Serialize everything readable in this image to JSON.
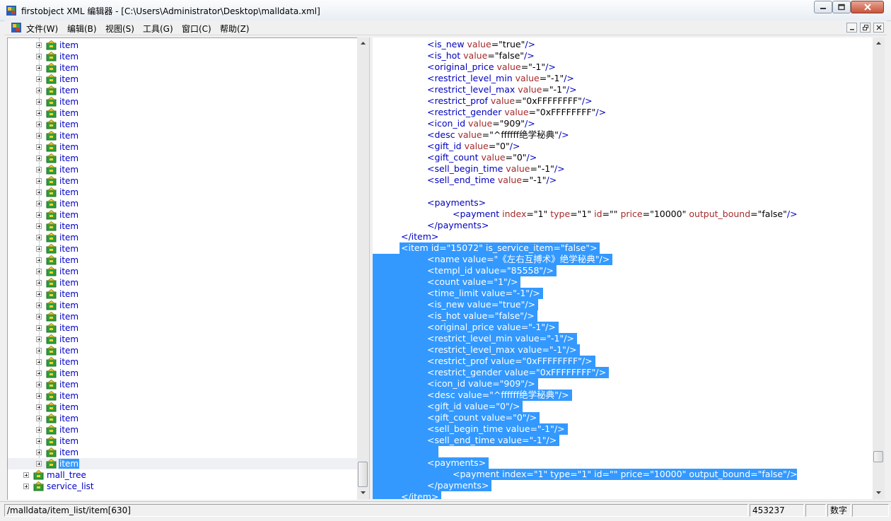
{
  "window": {
    "title": "firstobject XML 编辑器 - [C:\\Users\\Administrator\\Desktop\\malldata.xml]",
    "icon": "app-icon",
    "controls": [
      "minimize-icon",
      "maximize-icon",
      "close-icon"
    ]
  },
  "menu": {
    "items": [
      "文件(W)",
      "编辑(B)",
      "视图(S)",
      "工具(G)",
      "窗口(C)",
      "帮助(Z)"
    ]
  },
  "tree": {
    "item_label": "item",
    "item_count": 38,
    "selected_index": 37,
    "siblings": [
      "mall_tree",
      "service_list"
    ]
  },
  "xml": {
    "lines": [
      {
        "indent": 2,
        "parts": [
          [
            "b",
            "<is_new "
          ],
          [
            "r",
            "value"
          ],
          [
            "k",
            "=\""
          ],
          [
            "k",
            "true"
          ],
          [
            "k",
            "\""
          ],
          [
            "b",
            "/>"
          ]
        ]
      },
      {
        "indent": 2,
        "parts": [
          [
            "b",
            "<is_hot "
          ],
          [
            "r",
            "value"
          ],
          [
            "k",
            "=\""
          ],
          [
            "k",
            "false"
          ],
          [
            "k",
            "\""
          ],
          [
            "b",
            "/>"
          ]
        ]
      },
      {
        "indent": 2,
        "parts": [
          [
            "b",
            "<original_price "
          ],
          [
            "r",
            "value"
          ],
          [
            "k",
            "=\""
          ],
          [
            "k",
            "-1"
          ],
          [
            "k",
            "\""
          ],
          [
            "b",
            "/>"
          ]
        ]
      },
      {
        "indent": 2,
        "parts": [
          [
            "b",
            "<restrict_level_min "
          ],
          [
            "r",
            "value"
          ],
          [
            "k",
            "=\""
          ],
          [
            "k",
            "-1"
          ],
          [
            "k",
            "\""
          ],
          [
            "b",
            "/>"
          ]
        ]
      },
      {
        "indent": 2,
        "parts": [
          [
            "b",
            "<restrict_level_max "
          ],
          [
            "r",
            "value"
          ],
          [
            "k",
            "=\""
          ],
          [
            "k",
            "-1"
          ],
          [
            "k",
            "\""
          ],
          [
            "b",
            "/>"
          ]
        ]
      },
      {
        "indent": 2,
        "parts": [
          [
            "b",
            "<restrict_prof "
          ],
          [
            "r",
            "value"
          ],
          [
            "k",
            "=\""
          ],
          [
            "k",
            "0xFFFFFFFF"
          ],
          [
            "k",
            "\""
          ],
          [
            "b",
            "/>"
          ]
        ]
      },
      {
        "indent": 2,
        "parts": [
          [
            "b",
            "<restrict_gender "
          ],
          [
            "r",
            "value"
          ],
          [
            "k",
            "=\""
          ],
          [
            "k",
            "0xFFFFFFFF"
          ],
          [
            "k",
            "\""
          ],
          [
            "b",
            "/>"
          ]
        ]
      },
      {
        "indent": 2,
        "parts": [
          [
            "b",
            "<icon_id "
          ],
          [
            "r",
            "value"
          ],
          [
            "k",
            "=\""
          ],
          [
            "k",
            "909"
          ],
          [
            "k",
            "\""
          ],
          [
            "b",
            "/>"
          ]
        ]
      },
      {
        "indent": 2,
        "parts": [
          [
            "b",
            "<desc "
          ],
          [
            "r",
            "value"
          ],
          [
            "k",
            "=\""
          ],
          [
            "k",
            "^ffffff绝学秘典"
          ],
          [
            "k",
            "\""
          ],
          [
            "b",
            "/>"
          ]
        ]
      },
      {
        "indent": 2,
        "parts": [
          [
            "b",
            "<gift_id "
          ],
          [
            "r",
            "value"
          ],
          [
            "k",
            "=\""
          ],
          [
            "k",
            "0"
          ],
          [
            "k",
            "\""
          ],
          [
            "b",
            "/>"
          ]
        ]
      },
      {
        "indent": 2,
        "parts": [
          [
            "b",
            "<gift_count "
          ],
          [
            "r",
            "value"
          ],
          [
            "k",
            "=\""
          ],
          [
            "k",
            "0"
          ],
          [
            "k",
            "\""
          ],
          [
            "b",
            "/>"
          ]
        ]
      },
      {
        "indent": 2,
        "parts": [
          [
            "b",
            "<sell_begin_time "
          ],
          [
            "r",
            "value"
          ],
          [
            "k",
            "=\""
          ],
          [
            "k",
            "-1"
          ],
          [
            "k",
            "\""
          ],
          [
            "b",
            "/>"
          ]
        ]
      },
      {
        "indent": 2,
        "parts": [
          [
            "b",
            "<sell_end_time "
          ],
          [
            "r",
            "value"
          ],
          [
            "k",
            "=\""
          ],
          [
            "k",
            "-1"
          ],
          [
            "k",
            "\""
          ],
          [
            "b",
            "/>"
          ]
        ]
      },
      {
        "indent": 0,
        "parts": []
      },
      {
        "indent": 2,
        "parts": [
          [
            "b",
            "<payments>"
          ]
        ]
      },
      {
        "indent": 3,
        "parts": [
          [
            "b",
            "<payment "
          ],
          [
            "r",
            "index"
          ],
          [
            "k",
            "=\"1\" "
          ],
          [
            "r",
            "type"
          ],
          [
            "k",
            "=\"1\" "
          ],
          [
            "r",
            "id"
          ],
          [
            "k",
            "=\"\" "
          ],
          [
            "r",
            "price"
          ],
          [
            "k",
            "=\"10000\" "
          ],
          [
            "r",
            "output_bound"
          ],
          [
            "k",
            "=\"false\""
          ],
          [
            "b",
            "/>"
          ]
        ]
      },
      {
        "indent": 2,
        "parts": [
          [
            "b",
            "</payments>"
          ]
        ]
      },
      {
        "indent": 1,
        "parts": [
          [
            "b",
            "</item>"
          ]
        ]
      },
      {
        "indent": 1,
        "sel": true,
        "parts": [
          [
            "b",
            "<item "
          ],
          [
            "r",
            "id"
          ],
          [
            "k",
            "=\"15072\" "
          ],
          [
            "r",
            "is_service_item"
          ],
          [
            "k",
            "=\"false\""
          ],
          [
            "b",
            ">"
          ]
        ]
      },
      {
        "indent": 2,
        "sel": true,
        "parts": [
          [
            "b",
            "<name "
          ],
          [
            "r",
            "value"
          ],
          [
            "k",
            "=\"《左右互搏术》绝学秘典\""
          ],
          [
            "b",
            "/>"
          ]
        ]
      },
      {
        "indent": 2,
        "sel": true,
        "parts": [
          [
            "b",
            "<templ_id "
          ],
          [
            "r",
            "value"
          ],
          [
            "k",
            "=\"85558\""
          ],
          [
            "b",
            "/>"
          ]
        ]
      },
      {
        "indent": 2,
        "sel": true,
        "parts": [
          [
            "b",
            "<count "
          ],
          [
            "r",
            "value"
          ],
          [
            "k",
            "=\"1\""
          ],
          [
            "b",
            "/>"
          ]
        ]
      },
      {
        "indent": 2,
        "sel": true,
        "parts": [
          [
            "b",
            "<time_limit "
          ],
          [
            "r",
            "value"
          ],
          [
            "k",
            "=\"-1\""
          ],
          [
            "b",
            "/>"
          ]
        ]
      },
      {
        "indent": 2,
        "sel": true,
        "parts": [
          [
            "b",
            "<is_new "
          ],
          [
            "r",
            "value"
          ],
          [
            "k",
            "=\"true\""
          ],
          [
            "b",
            "/>"
          ]
        ]
      },
      {
        "indent": 2,
        "sel": true,
        "parts": [
          [
            "b",
            "<is_hot "
          ],
          [
            "r",
            "value"
          ],
          [
            "k",
            "=\"false\""
          ],
          [
            "b",
            "/>"
          ]
        ]
      },
      {
        "indent": 2,
        "sel": true,
        "parts": [
          [
            "b",
            "<original_price "
          ],
          [
            "r",
            "value"
          ],
          [
            "k",
            "=\"-1\""
          ],
          [
            "b",
            "/>"
          ]
        ]
      },
      {
        "indent": 2,
        "sel": true,
        "parts": [
          [
            "b",
            "<restrict_level_min "
          ],
          [
            "r",
            "value"
          ],
          [
            "k",
            "=\"-1\""
          ],
          [
            "b",
            "/>"
          ]
        ]
      },
      {
        "indent": 2,
        "sel": true,
        "parts": [
          [
            "b",
            "<restrict_level_max "
          ],
          [
            "r",
            "value"
          ],
          [
            "k",
            "=\"-1\""
          ],
          [
            "b",
            "/>"
          ]
        ]
      },
      {
        "indent": 2,
        "sel": true,
        "parts": [
          [
            "b",
            "<restrict_prof "
          ],
          [
            "r",
            "value"
          ],
          [
            "k",
            "=\"0xFFFFFFFF\""
          ],
          [
            "b",
            "/>"
          ]
        ]
      },
      {
        "indent": 2,
        "sel": true,
        "parts": [
          [
            "b",
            "<restrict_gender "
          ],
          [
            "r",
            "value"
          ],
          [
            "k",
            "=\"0xFFFFFFFF\""
          ],
          [
            "b",
            "/>"
          ]
        ]
      },
      {
        "indent": 2,
        "sel": true,
        "parts": [
          [
            "b",
            "<icon_id "
          ],
          [
            "r",
            "value"
          ],
          [
            "k",
            "=\"909\""
          ],
          [
            "b",
            "/>"
          ]
        ]
      },
      {
        "indent": 2,
        "sel": true,
        "parts": [
          [
            "b",
            "<desc "
          ],
          [
            "r",
            "value"
          ],
          [
            "k",
            "=\"^ffffff绝学秘典\""
          ],
          [
            "b",
            "/>"
          ]
        ]
      },
      {
        "indent": 2,
        "sel": true,
        "parts": [
          [
            "b",
            "<gift_id "
          ],
          [
            "r",
            "value"
          ],
          [
            "k",
            "=\"0\""
          ],
          [
            "b",
            "/>"
          ]
        ]
      },
      {
        "indent": 2,
        "sel": true,
        "parts": [
          [
            "b",
            "<gift_count "
          ],
          [
            "r",
            "value"
          ],
          [
            "k",
            "=\"0\""
          ],
          [
            "b",
            "/>"
          ]
        ]
      },
      {
        "indent": 2,
        "sel": true,
        "parts": [
          [
            "b",
            "<sell_begin_time "
          ],
          [
            "r",
            "value"
          ],
          [
            "k",
            "=\"-1\""
          ],
          [
            "b",
            "/>"
          ]
        ]
      },
      {
        "indent": 2,
        "sel": true,
        "parts": [
          [
            "b",
            "<sell_end_time "
          ],
          [
            "r",
            "value"
          ],
          [
            "k",
            "=\"-1\""
          ],
          [
            "b",
            "/>"
          ]
        ]
      },
      {
        "indent": 2,
        "sel": true,
        "parts": []
      },
      {
        "indent": 2,
        "sel": true,
        "parts": [
          [
            "b",
            "<payments>"
          ]
        ]
      },
      {
        "indent": 3,
        "sel": true,
        "parts": [
          [
            "b",
            "<payment "
          ],
          [
            "r",
            "index"
          ],
          [
            "k",
            "=\"1\" "
          ],
          [
            "r",
            "type"
          ],
          [
            "k",
            "=\"1\" "
          ],
          [
            "r",
            "id"
          ],
          [
            "k",
            "=\"\" "
          ],
          [
            "r",
            "price"
          ],
          [
            "k",
            "=\"10000\" "
          ],
          [
            "r",
            "output_bound"
          ],
          [
            "k",
            "=\"false\""
          ],
          [
            "b",
            "/>"
          ]
        ]
      },
      {
        "indent": 2,
        "sel": true,
        "parts": [
          [
            "b",
            "</payments>"
          ]
        ]
      },
      {
        "indent": 1,
        "sel": true,
        "parts": [
          [
            "b",
            "</item>"
          ]
        ]
      }
    ]
  },
  "status": {
    "path": "/malldata/item_list/item[630]",
    "position": "453237",
    "blank": "",
    "mode": "数字"
  },
  "colors": {
    "tag": "#0000c0",
    "attr": "#a52a2a",
    "selection": "#3399ff",
    "tree_label": "#0000c8"
  }
}
